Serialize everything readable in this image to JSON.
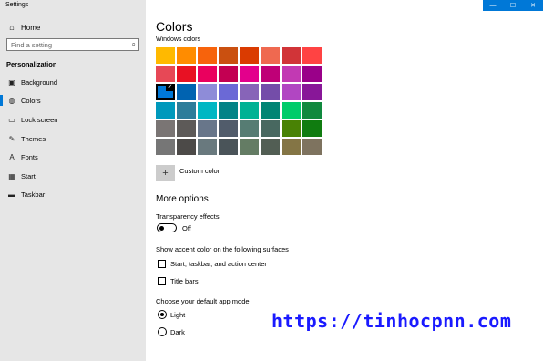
{
  "window": {
    "title": "Settings",
    "controls": [
      "—",
      "☐",
      "✕"
    ]
  },
  "sidebar": {
    "home_label": "Home",
    "search_placeholder": "Find a setting",
    "section_header": "Personalization",
    "items": [
      {
        "label": "Background",
        "icon": "picture-icon"
      },
      {
        "label": "Colors",
        "icon": "palette-icon",
        "selected": true
      },
      {
        "label": "Lock screen",
        "icon": "monitor-icon"
      },
      {
        "label": "Themes",
        "icon": "brush-icon"
      },
      {
        "label": "Fonts",
        "icon": "font-icon"
      },
      {
        "label": "Start",
        "icon": "start-icon"
      },
      {
        "label": "Taskbar",
        "icon": "taskbar-icon"
      }
    ]
  },
  "main": {
    "title": "Colors",
    "windows_colors_label": "Windows colors",
    "swatches": [
      [
        "#ffb900",
        "#ff8c00",
        "#f7630c",
        "#ca5010",
        "#da3b01",
        "#ef6950",
        "#d13438",
        "#ff4343"
      ],
      [
        "#e74856",
        "#e81123",
        "#ea005e",
        "#c30052",
        "#e3008c",
        "#bf0077",
        "#c239b3",
        "#9a0089"
      ],
      [
        "#0078d7",
        "#0063b1",
        "#8e8cd8",
        "#6b69d6",
        "#8764b8",
        "#744da9",
        "#b146c2",
        "#881798"
      ],
      [
        "#0099bc",
        "#2d7d9a",
        "#00b7c3",
        "#038387",
        "#00b294",
        "#018574",
        "#00cc6a",
        "#10893e"
      ],
      [
        "#7a7574",
        "#5d5a58",
        "#68768a",
        "#515c6b",
        "#567c73",
        "#486860",
        "#498205",
        "#107c10"
      ],
      [
        "#767676",
        "#4c4a48",
        "#69797e",
        "#4a5459",
        "#647c64",
        "#525e54",
        "#847545",
        "#7e735f"
      ]
    ],
    "selected_swatch": {
      "row": 2,
      "col": 0
    },
    "custom_color_label": "Custom color",
    "more_options_label": "More options",
    "transparency_label": "Transparency effects",
    "transparency_state": "Off",
    "accent_surfaces_label": "Show accent color on the following surfaces",
    "checkbox_start_label": "Start, taskbar, and action center",
    "checkbox_titlebars_label": "Title bars",
    "app_mode_label": "Choose your default app mode",
    "radio_light_label": "Light",
    "radio_dark_label": "Dark",
    "app_mode_selected": "Light"
  },
  "watermark": "https://tinhocpnn.com",
  "colors": {
    "accent": "#0078d7",
    "sidebar_bg": "#e6e6e6"
  }
}
